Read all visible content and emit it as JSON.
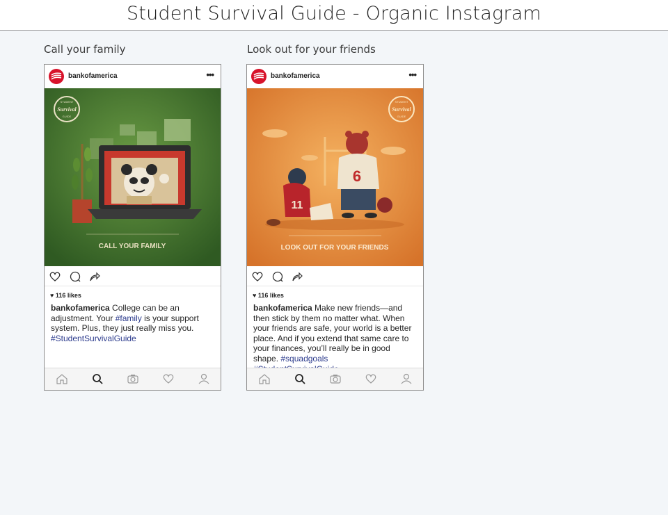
{
  "page": {
    "title": "Student Survival Guide - Organic Instagram"
  },
  "posts": [
    {
      "heading": "Call your family",
      "username": "bankofamerica",
      "more": "•••",
      "image_caption": "CALL YOUR FAMILY",
      "badge": [
        "STUDENT",
        "Survival",
        "GUIDE"
      ],
      "likes": "116 likes",
      "caption": {
        "user": "bankofamerica",
        "text1": " College can be an adjustment. Your ",
        "tag1": "#family",
        "text2": " is your support system. Plus, they just really miss you. ",
        "tag2": "#StudentSurvivalGuide"
      },
      "colors": {
        "bg": "#3e6e2c"
      }
    },
    {
      "heading": "Look out for your friends",
      "username": "bankofamerica",
      "more": "•••",
      "image_caption": "LOOK OUT FOR YOUR FRIENDS",
      "badge": [
        "STUDENT",
        "Survival",
        "GUIDE"
      ],
      "jersey_numbers": [
        "6",
        "11"
      ],
      "likes": "116 likes",
      "caption": {
        "user": "bankofamerica",
        "text1": " Make new friends—and then stick by them no matter what. When your friends are safe, your world is a better place. And if you extend that same care to your finances, you’ll really be in good shape. ",
        "tag1": "#squadgoals",
        "text2": " ",
        "tag2": "#StudentSurvivalGuide"
      },
      "colors": {
        "bg": "#e0842f"
      }
    }
  ],
  "icons": {
    "actions": [
      "heart-icon",
      "comment-icon",
      "share-icon"
    ],
    "nav": [
      "home-icon",
      "search-icon",
      "camera-icon",
      "heart-icon",
      "profile-icon"
    ]
  }
}
